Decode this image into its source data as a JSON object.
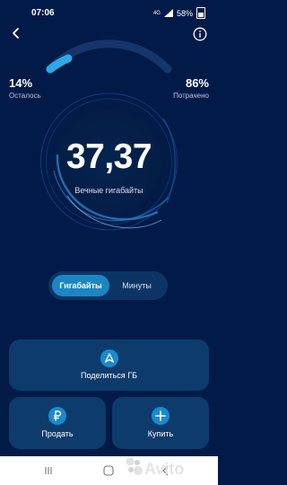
{
  "status_bar": {
    "time": "07:06",
    "network": "4G",
    "battery": "58%"
  },
  "stats": {
    "left_percent": "14%",
    "left_label": "Осталось",
    "right_percent": "86%",
    "right_label": "Потрачено",
    "remaining_fraction": 0.14
  },
  "main": {
    "value": "37,37",
    "label": "Вечные гигабайты"
  },
  "toggle": {
    "option_gb": "Гигабайты",
    "option_min": "Минуты",
    "selected": "Гигабайты"
  },
  "actions": {
    "share": "Поделиться ГБ",
    "sell": "Продать",
    "buy": "Купить"
  },
  "watermark": {
    "text": "Avito"
  },
  "colors": {
    "background": "#021a48",
    "accent": "#1a87c4",
    "card": "#0d3b6c"
  },
  "icons": [
    "back-arrow-icon",
    "info-icon",
    "share-triangle-icon",
    "ruble-icon",
    "plus-icon"
  ]
}
